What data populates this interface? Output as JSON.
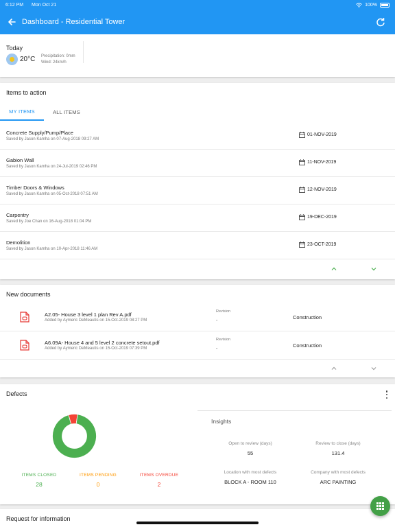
{
  "status_bar": {
    "time": "6:12 PM",
    "date": "Mon Oct 21",
    "battery": "100%"
  },
  "header": {
    "title": "Dashboard - Residential Tower"
  },
  "weather": {
    "label": "Today",
    "temperature": "20°C",
    "precipitation": "Precipitation: 0mm",
    "wind": "Wind: 24km/h"
  },
  "items_to_action": {
    "title": "Items to action",
    "tabs": [
      {
        "label": "MY ITEMS",
        "active": true
      },
      {
        "label": "ALL ITEMS",
        "active": false
      }
    ],
    "rows": [
      {
        "name": "Concrete Supply/Pump/Place",
        "saved": "Saved by Jason Kamha on 07-Aug-2018 09:27 AM",
        "date": "01-NOV-2019"
      },
      {
        "name": "Gabion Wall",
        "saved": "Saved by Jason Kamha on 24-Jul-2019 02:46 PM",
        "date": "11-NOV-2019"
      },
      {
        "name": "Timber Doors & Windows",
        "saved": "Saved by Jason Kamha on 05-Oct-2018 07:51 AM",
        "date": "12-NOV-2019"
      },
      {
        "name": "Carpentry",
        "saved": "Saved by Joe Chan on 16-Aug-2018 01:04 PM",
        "date": "19-DEC-2019"
      },
      {
        "name": "Demolition",
        "saved": "Saved by Jason Kamha on 10-Apr-2018 11:46 AM",
        "date": "23-OCT-2019"
      }
    ]
  },
  "new_documents": {
    "title": "New documents",
    "rows": [
      {
        "name": "A2.05- House 3 level 1 plan Rev A.pdf",
        "added": "Added by Aymeric DeMeautis on 15-Oct-2019 08:27 PM",
        "revision_label": "Revision",
        "revision": "-",
        "category": "Construction"
      },
      {
        "name": "A6.09A- House 4 and 5 level 2 concrete setout.pdf",
        "added": "Added by Aymeric DeMeautis on 15-Oct-2019 07:39 PM",
        "revision_label": "Revision",
        "revision": "-",
        "category": "Construction"
      }
    ]
  },
  "defects": {
    "title": "Defects",
    "stats": [
      {
        "label": "ITEMS CLOSED",
        "value": "28",
        "color": "#4caf50"
      },
      {
        "label": "ITEMS PENDING",
        "value": "0",
        "color": "#ff9800"
      },
      {
        "label": "ITEMS OVERDUE",
        "value": "2",
        "color": "#f44336"
      }
    ],
    "insights": {
      "title": "Insights",
      "open_to_review_label": "Open to review (days)",
      "open_to_review": "55",
      "review_to_close_label": "Review to close (days)",
      "review_to_close": "131.4",
      "location_label": "Location with most defects",
      "location": "BLOCK A - ROOM 110",
      "company_label": "Company with most defects",
      "company": "ARC PAINTING"
    }
  },
  "request_for_information": {
    "title": "Request for information"
  },
  "colors": {
    "primary": "#2196f3",
    "green": "#4caf50",
    "orange": "#ff9800",
    "red": "#f44336",
    "doc_icon": "#e53935"
  }
}
